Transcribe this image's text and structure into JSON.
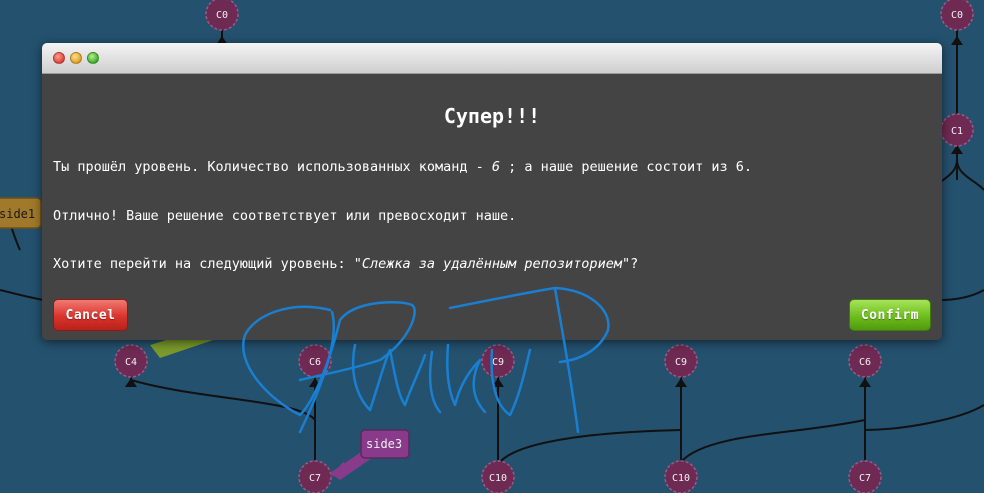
{
  "colors": {
    "background": "#24516e",
    "node_fill": "#6e2a52",
    "branch_side1": "#a07a2a",
    "branch_side3": "#8a3a8a",
    "signature": "#1a7fd0"
  },
  "graph": {
    "commits": [
      "C0",
      "C0",
      "C1",
      "C4",
      "C6",
      "C9",
      "C9",
      "C6",
      "C7",
      "C10",
      "C10",
      "C7"
    ],
    "branches": [
      "side1",
      "side3"
    ]
  },
  "dialog": {
    "title": "Супер!!!",
    "line1_prefix": "Ты прошёл уровень. Количество использованных команд - ",
    "line1_count": "6",
    "line1_suffix": " ; а наше решение состоит из 6.",
    "line2": "Отлично! Ваше решение соответствует или превосходит наше.",
    "line3_prefix": "Хотите перейти на следующий уровень: ",
    "line3_level": "\"Слежка за удалённым репозиторием\"",
    "line3_suffix": "?",
    "cancel_label": "Cancel",
    "confirm_label": "Confirm"
  },
  "window_controls": [
    "close-icon",
    "minimize-icon",
    "zoom-icon"
  ]
}
